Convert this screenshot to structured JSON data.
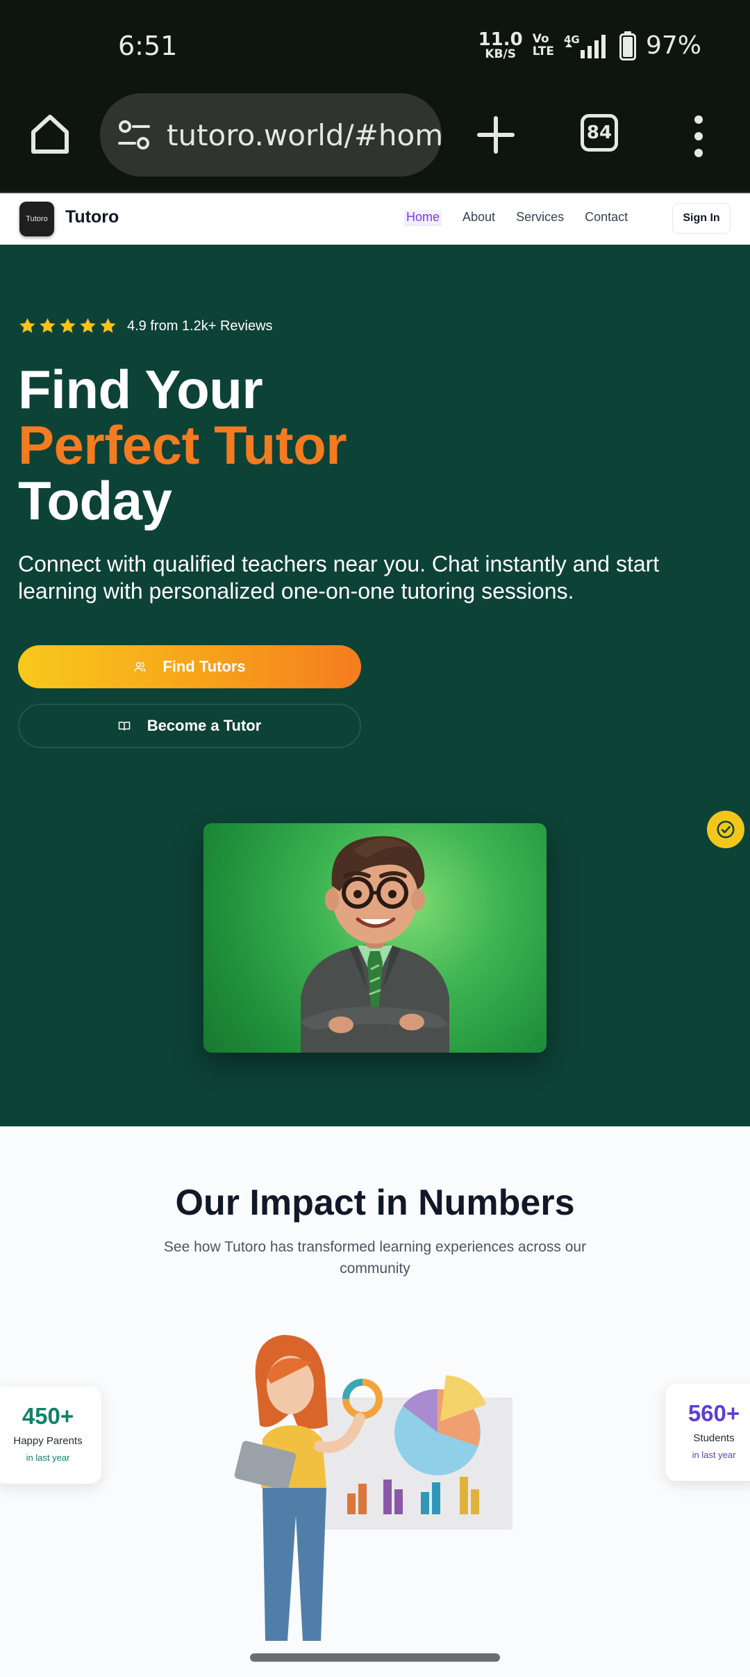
{
  "status_bar": {
    "time": "6:51",
    "net_speed_value": "11.0",
    "net_speed_unit": "KB/S",
    "volte_top": "Vo",
    "volte_bottom": "LTE",
    "network": "4G",
    "battery": "97%"
  },
  "browser": {
    "url": "tutoro.world/#home",
    "tab_count": "84"
  },
  "site_nav": {
    "logo_text": "Tutoro",
    "brand": "Tutoro",
    "links": [
      {
        "label": "Home",
        "active": true
      },
      {
        "label": "About",
        "active": false
      },
      {
        "label": "Services",
        "active": false
      },
      {
        "label": "Contact",
        "active": false
      }
    ],
    "signin_label": "Sign In"
  },
  "hero": {
    "rating_text": "4.9 from 1.2k+ Reviews",
    "stars": 5,
    "headline_line1": "Find Your",
    "headline_line2": "Perfect Tutor",
    "headline_line3": "Today",
    "subtext": "Connect with qualified teachers near you. Chat instantly and start learning with personalized one-on-one tutoring sessions.",
    "primary_button": "Find Tutors",
    "secondary_button": "Become a Tutor"
  },
  "impact": {
    "title": "Our Impact in Numbers",
    "subtitle": "See how Tutoro has transformed learning experiences across our community",
    "stats": [
      {
        "value": "450+",
        "label": "Happy Parents",
        "period": "in last year"
      },
      {
        "value": "560+",
        "label": "Students",
        "period": "in last year"
      }
    ]
  },
  "colors": {
    "hero_bg": "#0d4237",
    "accent_orange": "#f47b20",
    "star_yellow": "#f6c21c",
    "nav_active": "#7c3aed"
  },
  "icons": {
    "home": "home-icon",
    "tune": "tune-icon",
    "new_tab": "plus-icon",
    "more": "more-vert-icon",
    "find_tutors": "user-icon",
    "become_tutor": "book-open-icon",
    "badge": "check-circle-icon"
  }
}
